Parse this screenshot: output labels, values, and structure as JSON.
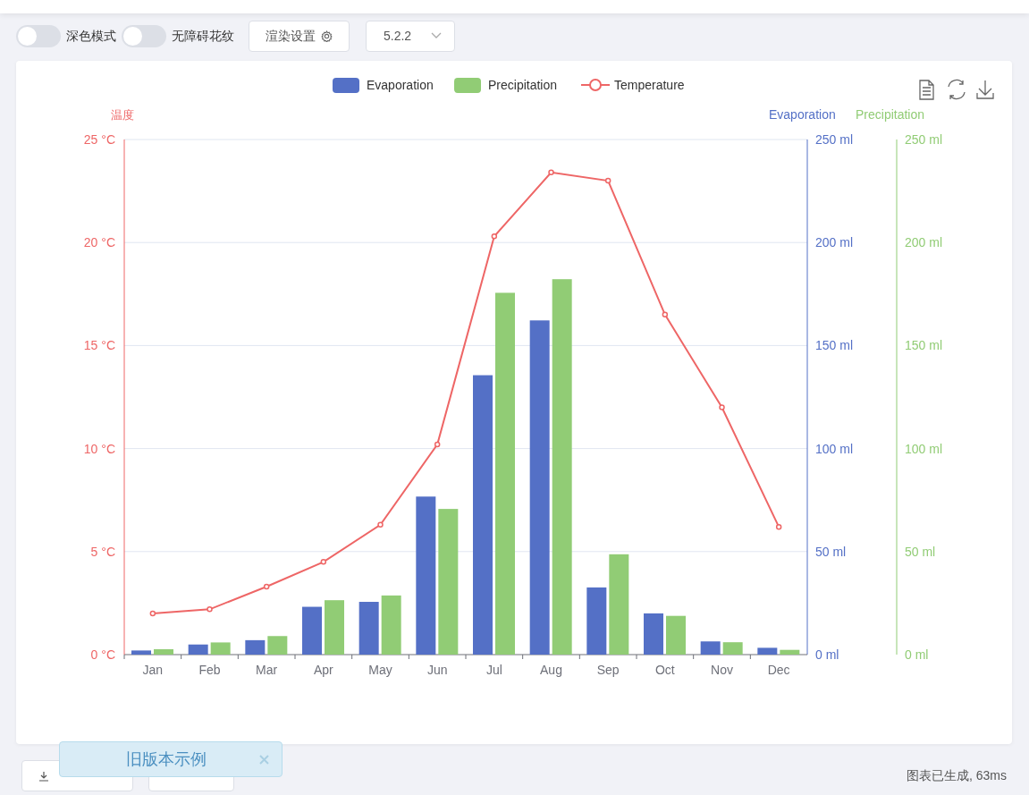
{
  "toolbar": {
    "toggles": [
      {
        "label": "深色模式",
        "on": false
      },
      {
        "label": "无障碍花纹",
        "on": false
      }
    ],
    "render_button": "渲染设置",
    "version": "5.2.2"
  },
  "bar_chart": {
    "chart_data": {
      "type": "bar",
      "legend": "top",
      "grid": true,
      "categories": [
        "Jan",
        "Feb",
        "Mar",
        "Apr",
        "May",
        "Jun",
        "Jul",
        "Aug",
        "Sep",
        "Oct",
        "Nov",
        "Dec"
      ],
      "ylabel": "Evaporation",
      "ylim": [
        0,
        250
      ],
      "yticks": [
        {
          "value": 0,
          "label": "0 ml"
        },
        {
          "value": 50,
          "label": "50 ml"
        },
        {
          "value": 100,
          "label": "100 ml"
        },
        {
          "value": 150,
          "label": "150 ml"
        },
        {
          "value": 200,
          "label": "200 ml"
        },
        {
          "value": 250,
          "label": "250 ml"
        }
      ],
      "series": [
        {
          "name": "Evaporation",
          "color": "#5470c6",
          "values": [
            2.0,
            4.9,
            7.0,
            23.2,
            25.6,
            76.7,
            135.6,
            162.2,
            32.6,
            20.0,
            6.4,
            3.3
          ]
        },
        {
          "name": "Precipitation",
          "color": "#91cc75",
          "values": [
            2.6,
            5.9,
            9.0,
            26.4,
            28.7,
            70.7,
            175.6,
            182.2,
            48.7,
            18.8,
            6.0,
            2.3
          ]
        }
      ]
    }
  },
  "line_chart": {
    "chart_data": {
      "type": "line",
      "legend": "top",
      "ylabel": "温度",
      "ylim": [
        0,
        25
      ],
      "yticks": [
        {
          "value": 0,
          "label": "0 °C"
        },
        {
          "value": 5,
          "label": "5 °C"
        },
        {
          "value": 10,
          "label": "10 °C"
        },
        {
          "value": 15,
          "label": "15 °C"
        },
        {
          "value": 20,
          "label": "20 °C"
        },
        {
          "value": 25,
          "label": "25 °C"
        }
      ],
      "series": [
        {
          "name": "Temperature",
          "color": "#ee6666",
          "marker": "circle",
          "values": [
            2.0,
            2.2,
            3.3,
            4.5,
            6.3,
            10.2,
            20.3,
            23.4,
            23.0,
            16.5,
            12.0,
            6.2
          ]
        }
      ]
    }
  },
  "precipitation_axis": {
    "title": "Precipitation",
    "color": "#91cc75",
    "ticks": [
      "250 ml",
      "200 ml",
      "150 ml",
      "100 ml",
      "50 ml",
      "0 ml"
    ]
  },
  "footer": {
    "status": "图表已生成, 63ms"
  },
  "toast": {
    "text": "旧版本示例"
  }
}
